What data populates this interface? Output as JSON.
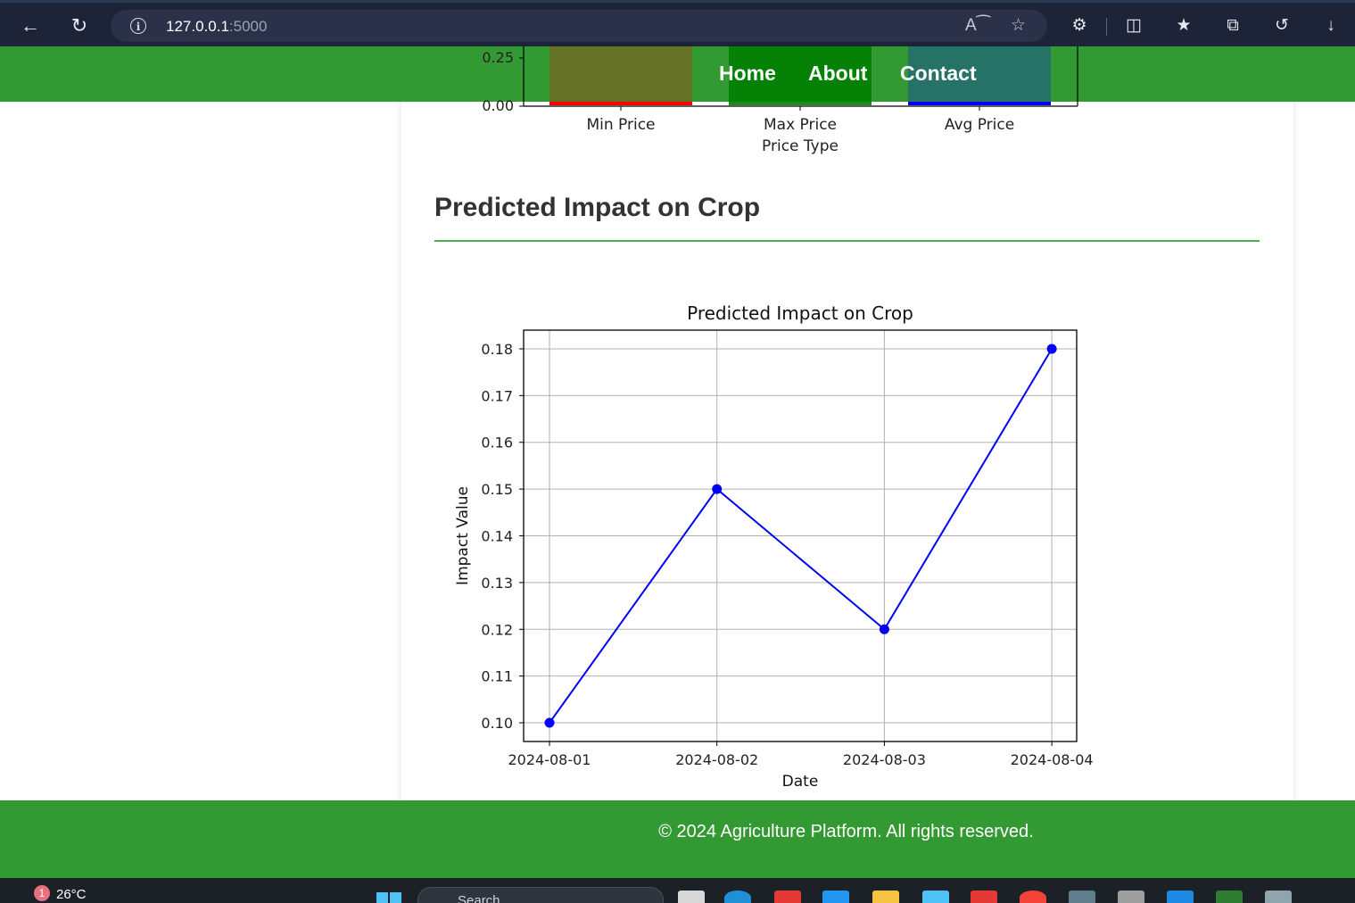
{
  "browser": {
    "url_host": "127.0.0.1",
    "url_port": ":5000"
  },
  "nav": {
    "home": "Home",
    "about": "About",
    "contact": "Contact"
  },
  "price_chart": {
    "categories": [
      "Min Price",
      "Max Price",
      "Avg Price"
    ],
    "xlabel": "Price Type",
    "visible_ticks": [
      "0.25",
      "0.00"
    ]
  },
  "section": {
    "title": "Predicted Impact on Crop"
  },
  "chart_data": {
    "type": "line",
    "title": "Predicted Impact on Crop",
    "xlabel": "Date",
    "ylabel": "Impact Value",
    "x": [
      "2024-08-01",
      "2024-08-02",
      "2024-08-03",
      "2024-08-04"
    ],
    "y": [
      0.1,
      0.15,
      0.12,
      0.18
    ],
    "yticks": [
      "0.10",
      "0.11",
      "0.12",
      "0.13",
      "0.14",
      "0.15",
      "0.16",
      "0.17",
      "0.18"
    ],
    "ylim": [
      0.096,
      0.184
    ],
    "grid": true,
    "line_color": "#0000ff",
    "marker": "circle"
  },
  "footer": {
    "text": "© 2024 Agriculture Platform. All rights reserved."
  },
  "taskbar": {
    "temperature": "26°C",
    "notification_count": "1",
    "search_placeholder": "Search"
  },
  "colors": {
    "brand_green": "#339933",
    "rule_green": "#4caf50",
    "chrome_bg": "#1e2438"
  }
}
